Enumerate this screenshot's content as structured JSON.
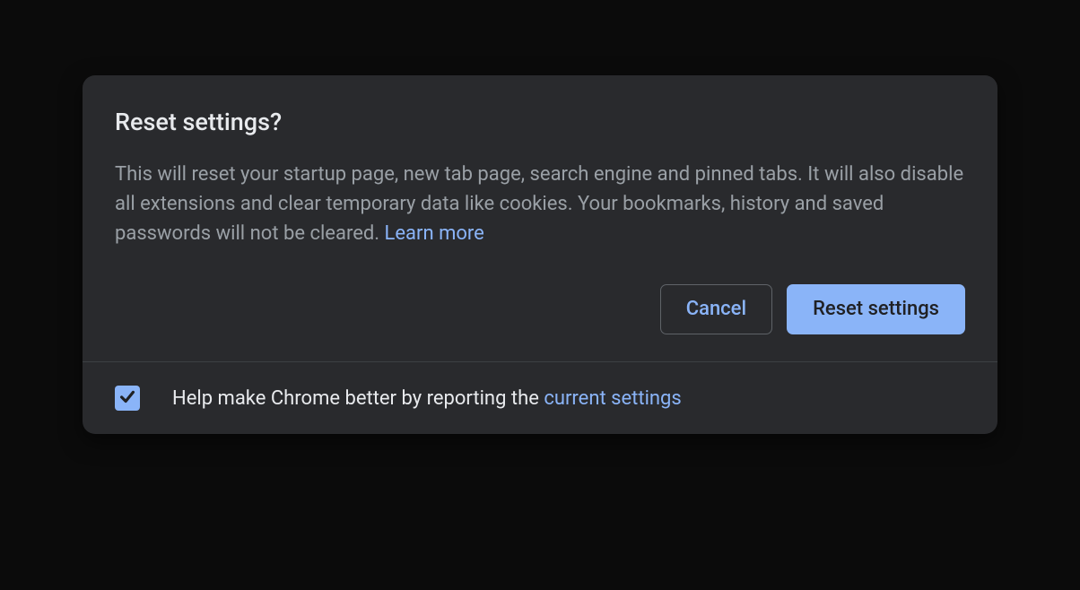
{
  "dialog": {
    "title": "Reset settings?",
    "body_text": "This will reset your startup page, new tab page, search engine and pinned tabs. It will also disable all extensions and clear temporary data like cookies. Your bookmarks, history and saved passwords will not be cleared. ",
    "learn_more": "Learn more",
    "cancel_label": "Cancel",
    "confirm_label": "Reset settings",
    "footer_text": "Help make Chrome better by reporting the ",
    "footer_link": "current settings",
    "checkbox_checked": true
  },
  "colors": {
    "accent": "#8ab4f8",
    "surface": "#292a2d",
    "text_primary": "#e8eaed",
    "text_secondary": "#9aa0a6",
    "border": "#5f6368"
  }
}
